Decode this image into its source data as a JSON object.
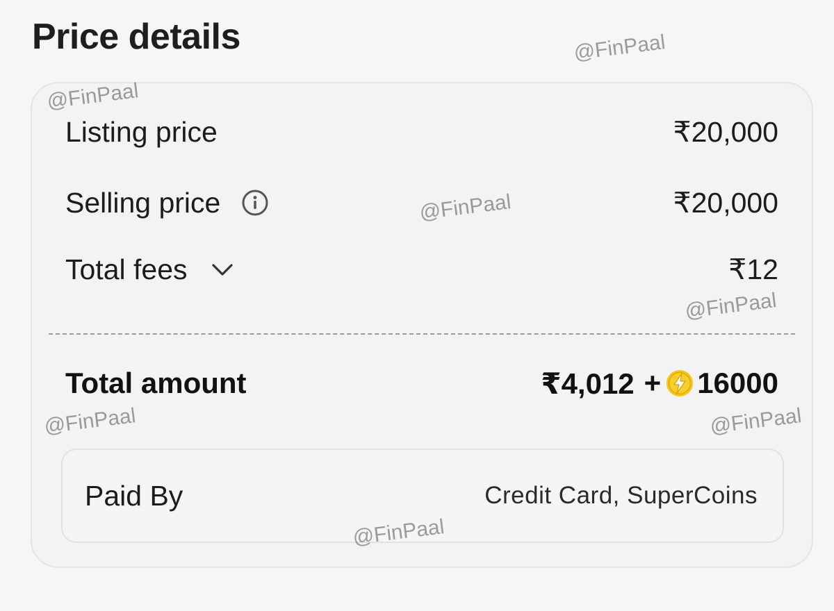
{
  "page": {
    "title": "Price details"
  },
  "price_rows": {
    "listing": {
      "label": "Listing price",
      "value": "₹20,000"
    },
    "selling": {
      "label": "Selling price",
      "value": "₹20,000",
      "icon": "info-icon"
    },
    "fees": {
      "label": "Total fees",
      "value": "₹12",
      "icon": "chevron-down-icon"
    }
  },
  "total": {
    "label": "Total amount",
    "cash": "₹4,012",
    "plus": "+",
    "coins": "16000",
    "coin_icon": "supercoin-icon",
    "coin_color": "#f5c518"
  },
  "paid_by": {
    "label": "Paid By",
    "value": "Credit Card, SuperCoins"
  },
  "watermark": {
    "text": "@FinPaal"
  }
}
